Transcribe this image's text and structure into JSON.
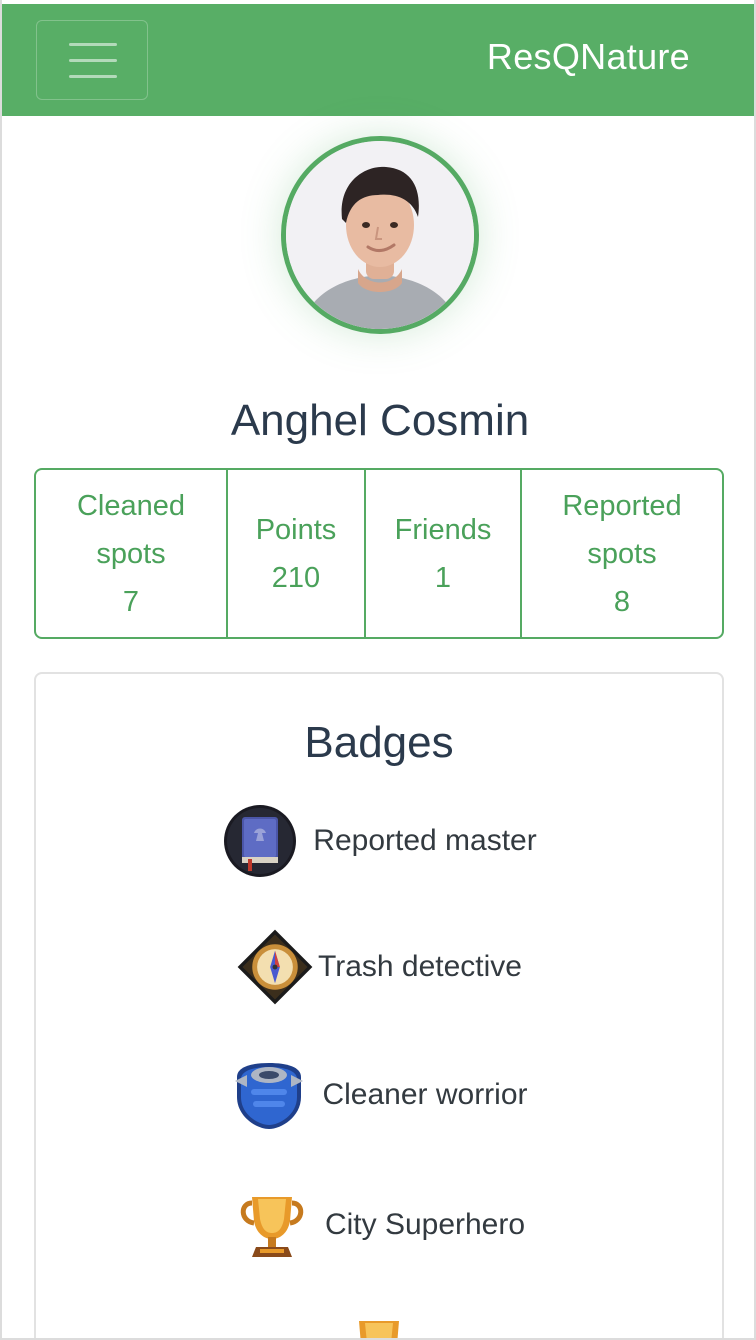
{
  "header": {
    "brand": "ResQNature",
    "menu_icon": "hamburger-menu-icon",
    "background_color": "#58ae66"
  },
  "profile": {
    "name": "Anghel Cosmin",
    "avatar_icon": "user-avatar-photo",
    "accent_color": "#55aa63"
  },
  "stats": [
    {
      "label_line1": "Cleaned",
      "label_line2": "spots",
      "value": "7"
    },
    {
      "label_line1": "Points",
      "label_line2": "",
      "value": "210"
    },
    {
      "label_line1": "Friends",
      "label_line2": "",
      "value": "1"
    },
    {
      "label_line1": "Reported",
      "label_line2": "spots",
      "value": "8"
    }
  ],
  "badges": {
    "title": "Badges",
    "items": [
      {
        "label": "Reported master",
        "icon": "book-badge-icon"
      },
      {
        "label": "Trash detective",
        "icon": "compass-badge-icon"
      },
      {
        "label": "Cleaner worrior",
        "icon": "armor-badge-icon"
      },
      {
        "label": "City Superhero",
        "icon": "trophy-badge-icon"
      }
    ]
  }
}
